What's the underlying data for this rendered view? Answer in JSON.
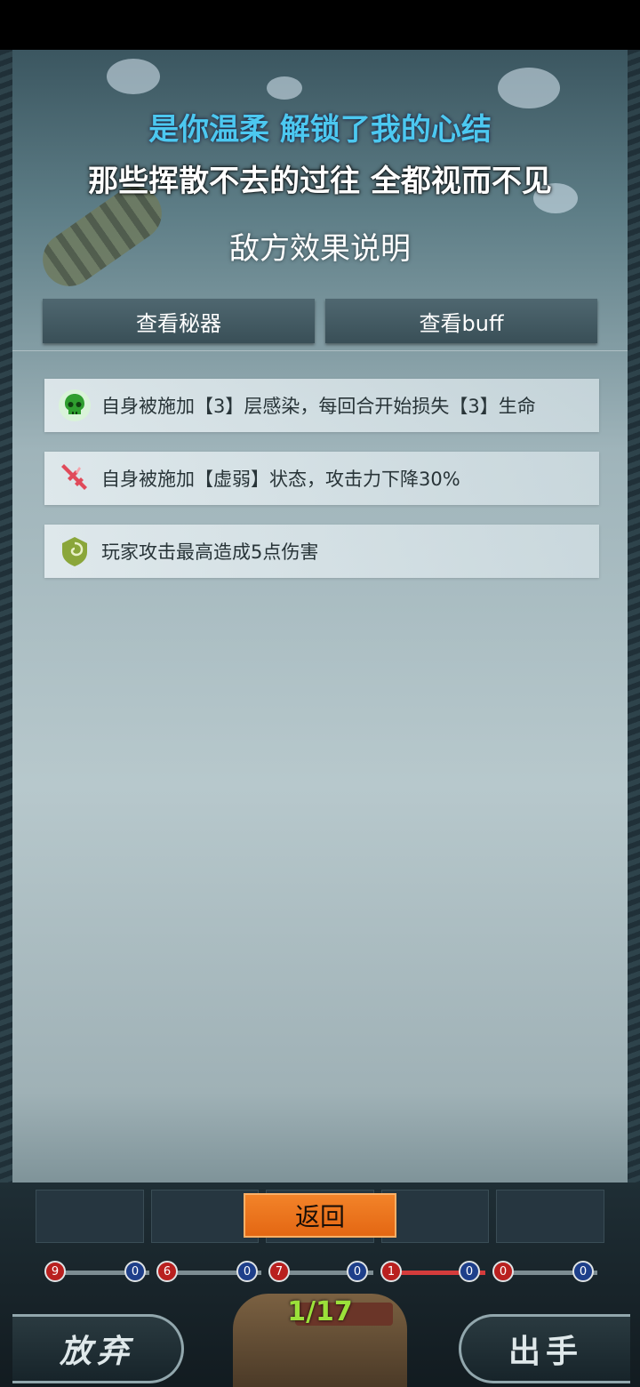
{
  "lyrics": {
    "line1": "是你温柔 解锁了我的心结",
    "line2": "那些挥散不去的过往 全都视而不见"
  },
  "panel": {
    "title": "敌方效果说明",
    "tabs": [
      {
        "label": "查看秘器"
      },
      {
        "label": "查看buff"
      }
    ],
    "effects": [
      {
        "icon": "skull-icon",
        "text": "自身被施加【3】层感染，每回合开始损失【3】生命",
        "color": "#3aa83a"
      },
      {
        "icon": "broken-sword-icon",
        "text": "自身被施加【虚弱】状态，攻击力下降30%",
        "color": "#e04a5a"
      },
      {
        "icon": "swirl-shield-icon",
        "text": "玩家攻击最高造成5点伤害",
        "color": "#9ab83a"
      }
    ]
  },
  "back_button": {
    "label": "返回"
  },
  "gauges": [
    {
      "left": "9",
      "right": "0"
    },
    {
      "left": "6",
      "right": "0"
    },
    {
      "left": "7",
      "right": "0"
    },
    {
      "left": "1",
      "right": "0"
    },
    {
      "left": "0",
      "right": "0"
    }
  ],
  "counter": "1/17",
  "actions": {
    "give_up": "放弃",
    "play": "出手"
  }
}
